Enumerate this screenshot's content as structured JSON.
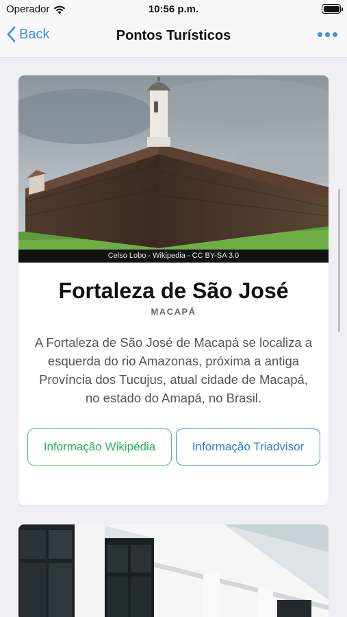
{
  "status_bar": {
    "carrier": "Operador",
    "time": "10:56 p.m.",
    "battery_level": 1.0
  },
  "nav": {
    "back_label": "Back",
    "title": "Pontos Turísticos",
    "more_icon": "ellipsis-icon"
  },
  "card": {
    "image_alt": "Fortaleza de São José",
    "photo_credit": "Celso Lobo - Wikipedia - CC BY-SA 3.0",
    "title": "Fortaleza de São José",
    "subtitle": "MACAPÁ",
    "description": "A Fortaleza de São José de Macapá se localiza a esquerda do rio Amazonas, próxima a antiga Província dos Tucujus, atual cidade de Macapá, no estado do Amapá, no Brasil.",
    "buttons": {
      "wikipedia": "Informação Wikipédia",
      "tripadvisor": "Informação Triadvisor"
    }
  },
  "colors": {
    "accent": "#3b8ff3",
    "wiki_green": "#25b158",
    "trip_blue": "#2f7fc6"
  }
}
